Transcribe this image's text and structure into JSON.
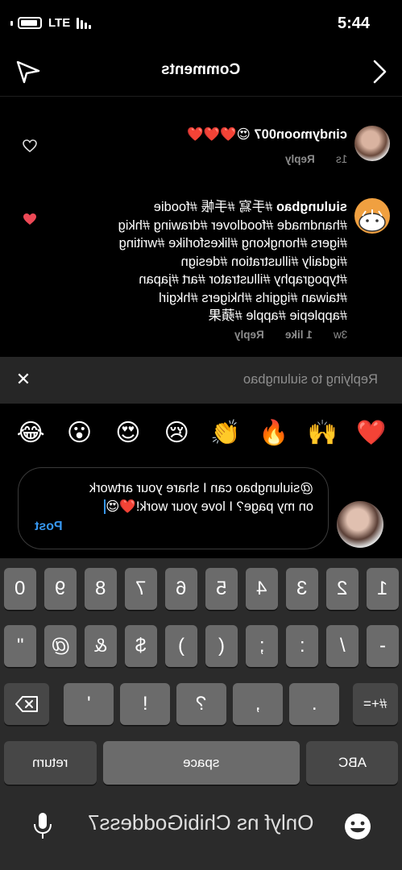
{
  "status_bar": {
    "time": "5:44",
    "network": "LTE"
  },
  "header": {
    "title": "Comments"
  },
  "comments": [
    {
      "username": "cindymoon007",
      "text": "😍❤️❤️❤️",
      "time": "1s",
      "reply_label": "Reply"
    },
    {
      "username": "siulungbao",
      "lines": [
        "#手寫 #手帳 #foodie",
        "#handmade #foodlover #drawing #hkig",
        "#igers #hongkong #likesforlike #writing",
        "#igdaily #illustration #design",
        "#typography #illustrator #art #japan",
        "#taiwan #iggirls #hkigers #hkgirl",
        "#applepie #apple #蘋果"
      ],
      "time": "3w",
      "likes": "1 like",
      "reply_label": "Reply"
    }
  ],
  "reply_bar": {
    "text": "Replying to siulungbao"
  },
  "emoji_bar": [
    "❤️",
    "🙌",
    "🔥",
    "👏",
    "😢",
    "😍",
    "😮",
    "😂"
  ],
  "composer": {
    "text": "@siulungbao can I share your artwork on my page? I love your work!❤️😍",
    "post_label": "Post"
  },
  "keyboard": {
    "row1": [
      "1",
      "2",
      "3",
      "4",
      "5",
      "6",
      "7",
      "8",
      "9",
      "0"
    ],
    "row2": [
      "-",
      "/",
      ":",
      ";",
      "(",
      ")",
      "$",
      "&",
      "@",
      "\""
    ],
    "row3_toggle": "#+=",
    "row3": [
      ".",
      ",",
      "?",
      "!",
      "'"
    ],
    "abc_label": "ABC",
    "space_label": "space",
    "return_label": "return",
    "overlay_text": "Onlyf ns ChibiGoddess7"
  },
  "colors": {
    "accent": "#3797f0",
    "heart_red": "#ed4956",
    "muted": "#8e8e8e"
  }
}
